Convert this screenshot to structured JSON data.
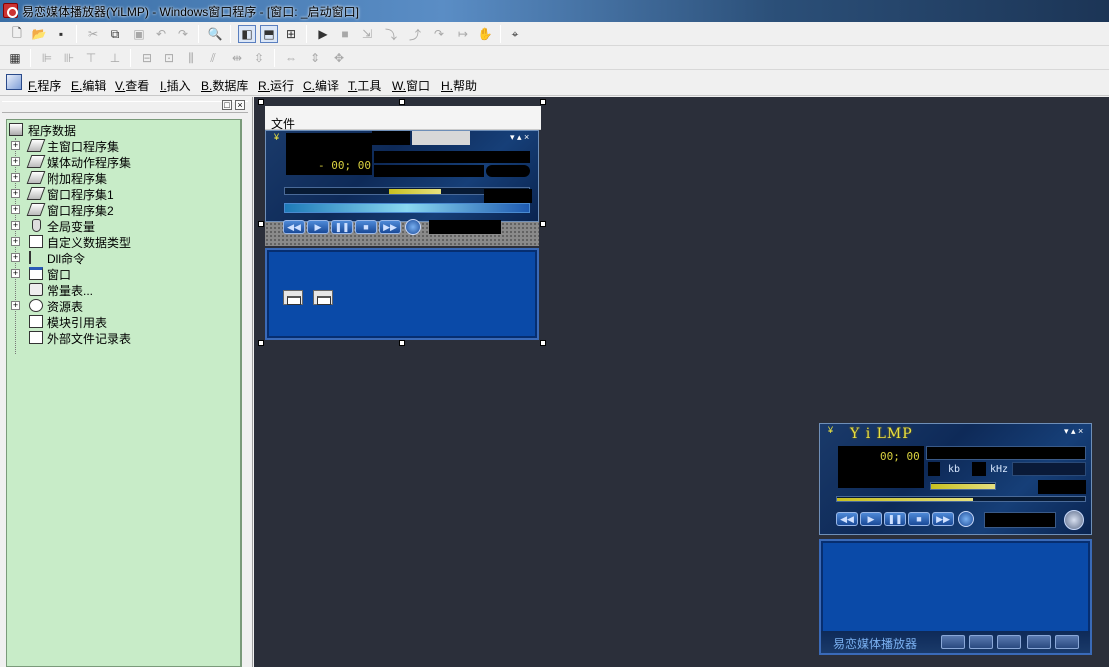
{
  "window": {
    "title": "易恋媒体播放器(YiLMP) - Windows窗口程序 - [窗口: _启动窗口]"
  },
  "toolbar1": {
    "icons": [
      "new-file-icon",
      "open-folder-icon",
      "save-icon",
      "cut-icon",
      "copy-icon",
      "paste-icon",
      "undo-icon",
      "redo-icon",
      "find-icon",
      "layout-left-icon",
      "layout-top-icon",
      "layout-grid-icon",
      "run-icon",
      "stop-icon",
      "step-icon",
      "step-into-icon",
      "step-out-icon",
      "step-over-icon",
      "run-to-cursor-icon",
      "hand-icon",
      "binoculars-icon"
    ]
  },
  "menu": {
    "items": [
      {
        "key": "F.",
        "label": "程序"
      },
      {
        "key": "E.",
        "label": "编辑"
      },
      {
        "key": "V.",
        "label": "查看"
      },
      {
        "key": "I.",
        "label": "插入"
      },
      {
        "key": "B.",
        "label": "数据库"
      },
      {
        "key": "R.",
        "label": "运行"
      },
      {
        "key": "C.",
        "label": "编译"
      },
      {
        "key": "T.",
        "label": "工具"
      },
      {
        "key": "W.",
        "label": "窗口"
      },
      {
        "key": "H.",
        "label": "帮助"
      }
    ]
  },
  "panel": {
    "pin": "□",
    "close": "×"
  },
  "tree": {
    "root": "程序数据",
    "items": [
      {
        "label": "主窗口程序集",
        "icon": "set",
        "exp": "+"
      },
      {
        "label": "媒体动作程序集",
        "icon": "set",
        "exp": "+"
      },
      {
        "label": "附加程序集",
        "icon": "set",
        "exp": "+"
      },
      {
        "label": "窗口程序集1",
        "icon": "set",
        "exp": "+"
      },
      {
        "label": "窗口程序集2",
        "icon": "set",
        "exp": "+"
      },
      {
        "label": "全局变量",
        "icon": "var",
        "exp": "+"
      },
      {
        "label": "自定义数据类型",
        "icon": "type",
        "exp": "+"
      },
      {
        "label": "Dll命令",
        "icon": "dll",
        "exp": "+"
      },
      {
        "label": "窗口",
        "icon": "win",
        "exp": "+"
      },
      {
        "label": "常量表...",
        "icon": "const",
        "exp": ""
      },
      {
        "label": "资源表",
        "icon": "res",
        "exp": "+"
      },
      {
        "label": "模块引用表",
        "icon": "mod",
        "exp": ""
      },
      {
        "label": "外部文件记录表",
        "icon": "file",
        "exp": ""
      }
    ]
  },
  "design": {
    "menu_label": "文件",
    "time": "- 00; 00",
    "window_ctrls": "▾ ▴ ×",
    "collapse": "¥"
  },
  "player": {
    "logo": "Y i LMP",
    "time": "00; 00",
    "kb": "kb",
    "khz": "kHz",
    "window_ctrls": "▾ ▴ ×",
    "collapse": "¥",
    "footer": "易恋媒体播放器",
    "seek_progress": 0.55
  },
  "colors": {
    "tree_bg": "#c8ecc8",
    "design_bg": "#2b2f3a",
    "playlist_bg": "#0a4aa8",
    "lcd_text": "#d8d040"
  }
}
